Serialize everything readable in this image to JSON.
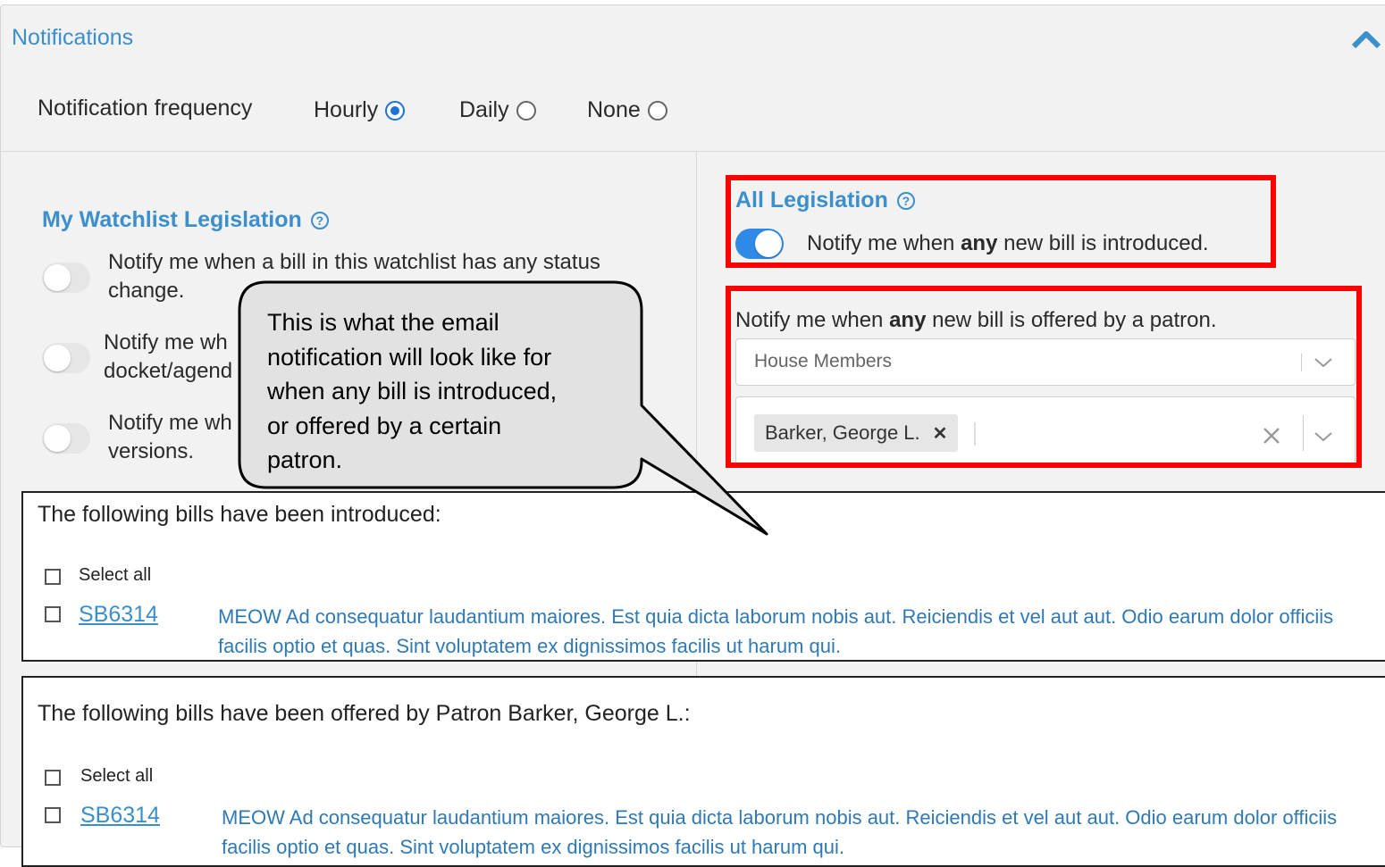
{
  "header": {
    "title": "Notifications"
  },
  "frequency": {
    "label": "Notification frequency",
    "options": [
      {
        "label": "Hourly",
        "selected": true
      },
      {
        "label": "Daily",
        "selected": false
      },
      {
        "label": "None",
        "selected": false
      }
    ]
  },
  "watchlist": {
    "title": "My Watchlist Legislation",
    "options": [
      {
        "line1": "Notify me when a bill in this watchlist has any status",
        "line2": "change.",
        "enabled": false
      },
      {
        "line1": "Notify me wh",
        "line2": "docket/agend",
        "enabled": false
      },
      {
        "line1": "Notify me wh",
        "line2": "versions.",
        "enabled": false
      }
    ]
  },
  "all_legislation": {
    "title": "All Legislation",
    "toggle_text_pre": "Notify me when ",
    "toggle_text_bold": "any",
    "toggle_text_post": " new bill is introduced.",
    "enabled": true
  },
  "patron": {
    "label_pre": "Notify me when ",
    "label_bold": "any",
    "label_post": " new bill is offered by a patron.",
    "chamber_select": "House Members",
    "selected_patron": "Barker, George L."
  },
  "callout": {
    "lines": [
      "This is what the email",
      "notification will look like for",
      "when any bill is introduced,",
      "or offered by a certain",
      "patron."
    ]
  },
  "email_introduced": {
    "heading": "The following bills have been introduced:",
    "select_all": "Select all",
    "bill_id": "SB6314",
    "desc_line1": "MEOW Ad consequatur laudantium maiores. Est quia dicta laborum nobis aut. Reiciendis et vel aut aut. Odio earum dolor officiis",
    "desc_line2": "facilis optio et quas. Sint voluptatem ex dignissimos facilis ut harum qui."
  },
  "email_offered": {
    "heading": "The following bills have been offered by Patron Barker, George L.:",
    "select_all": "Select all",
    "bill_id": "SB6314",
    "desc_line1": "MEOW Ad consequatur laudantium maiores. Est quia dicta laborum nobis aut. Reiciendis et vel aut aut. Odio earum dolor officiis",
    "desc_line2": "facilis optio et quas. Sint voluptatem ex dignissimos facilis ut harum qui."
  },
  "colors": {
    "accent": "#3b8fcb",
    "toggle_on": "#2e8ae6",
    "highlight": "#ff0000"
  }
}
